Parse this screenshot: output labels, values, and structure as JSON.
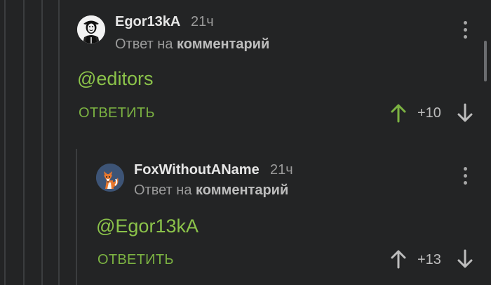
{
  "colors": {
    "background": "#232425",
    "accent_green": "#7cb342",
    "vote_up_active": "#7cb342",
    "vote_neutral": "#bdbdbd"
  },
  "comments": [
    {
      "author": "Egor13kA",
      "time": "21ч",
      "reply_prefix": "Ответ на",
      "reply_target": "комментарий",
      "text": "@editors",
      "reply_label": "ОТВЕТИТЬ",
      "rating": "+10",
      "avatar_icon": "anonymous-mask-icon",
      "upvoted": true
    },
    {
      "author": "FoxWithoutAName",
      "time": "21ч",
      "reply_prefix": "Ответ на",
      "reply_target": "комментарий",
      "text": "@Egor13kA",
      "reply_label": "ОТВЕТИТЬ",
      "rating": "+13",
      "avatar_icon": "fox-avatar-icon",
      "upvoted": false
    }
  ]
}
